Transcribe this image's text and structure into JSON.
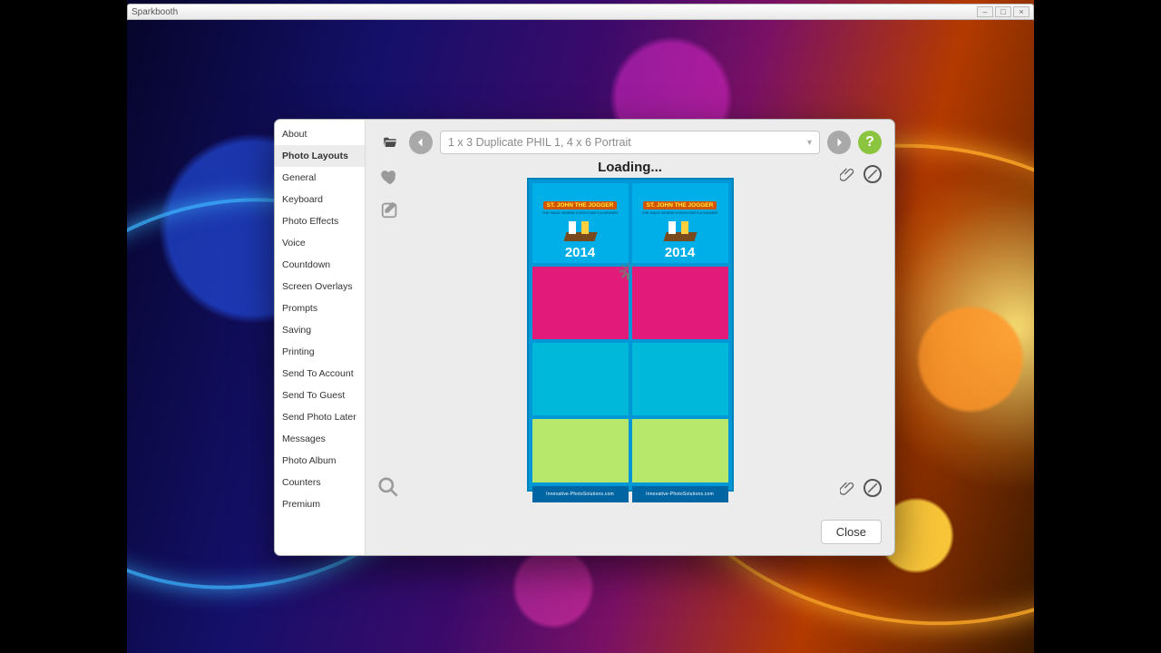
{
  "app": {
    "title": "Sparkbooth"
  },
  "window_controls": {
    "minimize": "–",
    "maximize": "□",
    "close": "×"
  },
  "sidebar": {
    "items": [
      {
        "label": "About"
      },
      {
        "label": "Photo Layouts"
      },
      {
        "label": "General"
      },
      {
        "label": "Keyboard"
      },
      {
        "label": "Photo Effects"
      },
      {
        "label": "Voice"
      },
      {
        "label": "Countdown"
      },
      {
        "label": "Screen Overlays"
      },
      {
        "label": "Prompts"
      },
      {
        "label": "Saving"
      },
      {
        "label": "Printing"
      },
      {
        "label": "Send To Account"
      },
      {
        "label": "Send To Guest"
      },
      {
        "label": "Send Photo Later"
      },
      {
        "label": "Messages"
      },
      {
        "label": "Photo Album"
      },
      {
        "label": "Counters"
      },
      {
        "label": "Premium"
      }
    ],
    "selected_index": 1
  },
  "toolbar": {
    "layout_selected": "1 x 3 Duplicate PHIL 1, 4 x 6 Portrait",
    "help_glyph": "?"
  },
  "status": {
    "loading": "Loading..."
  },
  "buttons": {
    "close": "Close"
  },
  "preview": {
    "banner": "ST. JOHN THE JOGGER",
    "subtitle": "THE RACE WHERE EVERYONE'S A WINNER",
    "year": "2014",
    "footer": "Innovative-PhotoSolutions.com"
  },
  "icons": {
    "folder": "folder-open-icon",
    "prev": "chevron-left-icon",
    "next": "chevron-right-icon",
    "help": "help-icon",
    "heart": "heart-icon",
    "edit": "edit-icon",
    "search": "search-icon",
    "paperclip": "paperclip-icon",
    "block": "block-icon"
  }
}
